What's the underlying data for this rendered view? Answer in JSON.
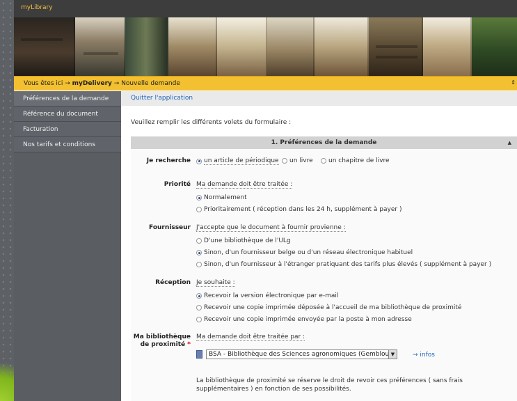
{
  "app": {
    "name": "myLibrary"
  },
  "breadcrumb": {
    "prefix": "Vous êtes ici",
    "arrow": "→",
    "section": "myDelivery",
    "page": "Nouvelle demande",
    "right_icon": "⇕"
  },
  "sidebar": {
    "items": [
      {
        "label": "Préférences de la demande"
      },
      {
        "label": "Référence du document"
      },
      {
        "label": "Facturation"
      },
      {
        "label": "Nos tarifs et conditions"
      }
    ]
  },
  "quit_label": "Quitter l'application",
  "intro": "Veuillez remplir les différents volets du formulaire :",
  "panel": {
    "title": "1. Préférences de la demande",
    "collapse_icon": "▲"
  },
  "recherche": {
    "label": "Je recherche",
    "options": [
      {
        "label": "un article de périodique",
        "checked": true
      },
      {
        "label": "un livre",
        "checked": false
      },
      {
        "label": "un chapitre de livre",
        "checked": false
      }
    ]
  },
  "priorite": {
    "label": "Priorité",
    "question": "Ma demande doit être traitée :",
    "options": [
      {
        "label": "Normalement",
        "checked": true
      },
      {
        "label": "Prioritairement ( réception dans les 24 h, supplément à payer )",
        "checked": false
      }
    ]
  },
  "fournisseur": {
    "label": "Fournisseur",
    "question": "J'accepte que le document à fournir provienne :",
    "options": [
      {
        "label": "D'une bibliothèque de l'ULg",
        "checked": false
      },
      {
        "label": "Sinon, d'un fournisseur belge ou d'un réseau électronique habituel",
        "checked": true
      },
      {
        "label": "Sinon, d'un fournisseur à l'étranger pratiquant des tarifs plus élevés ( supplément à payer )",
        "checked": false
      }
    ]
  },
  "reception": {
    "label": "Réception",
    "question": "Je souhaite :",
    "options": [
      {
        "label": "Recevoir la version électronique par e-mail",
        "checked": true
      },
      {
        "label": "Recevoir une copie imprimée déposée à l'accueil de ma bibliothèque de proximité",
        "checked": false
      },
      {
        "label": "Recevoir une copie imprimée envoyée par la poste à mon adresse",
        "checked": false
      }
    ]
  },
  "bibliotheque": {
    "label_line1": "Ma bibliothèque",
    "label_line2": "de proximité",
    "required": "*",
    "question": "Ma demande doit être traitée par :",
    "selected": "BSA - Bibliothèque des Sciences agronomiques (Gembloux)",
    "select_arrow": "▼",
    "infos_label": "→ infos",
    "note": "La bibliothèque de proximité se réserve le droit de revoir ces préférences ( sans frais supplémentaires ) en fonction de ses possibilités."
  }
}
